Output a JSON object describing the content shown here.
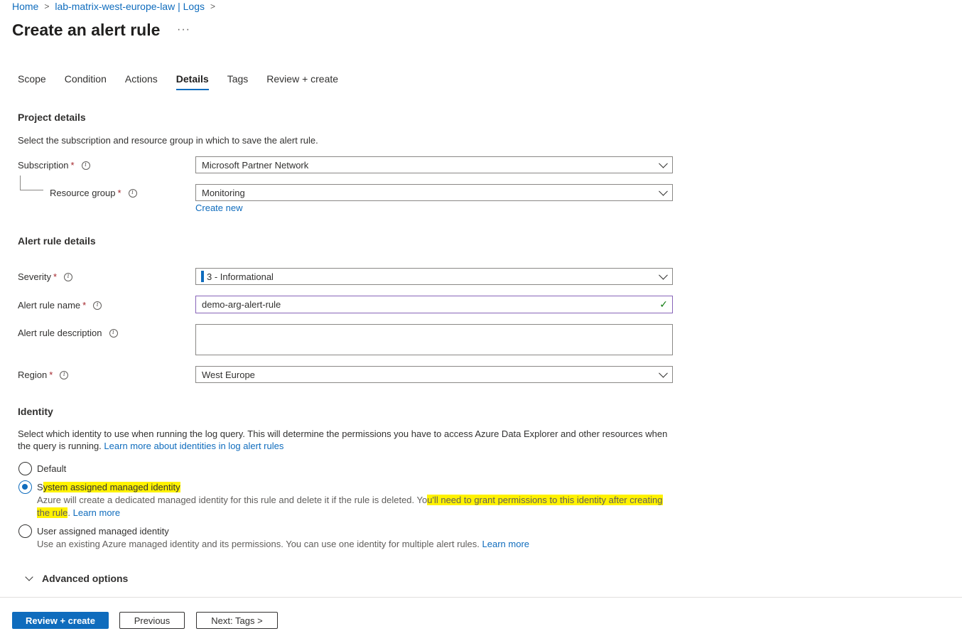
{
  "breadcrumb": {
    "items": [
      "Home",
      "lab-matrix-west-europe-law | Logs"
    ],
    "separator": ">"
  },
  "page": {
    "title": "Create an alert rule",
    "more": "···"
  },
  "tabs": [
    {
      "label": "Scope"
    },
    {
      "label": "Condition"
    },
    {
      "label": "Actions"
    },
    {
      "label": "Details",
      "active": true
    },
    {
      "label": "Tags"
    },
    {
      "label": "Review + create"
    }
  ],
  "project_details": {
    "heading": "Project details",
    "description": "Select the subscription and resource group in which to save the alert rule.",
    "subscription": {
      "label": "Subscription",
      "value": "Microsoft Partner Network"
    },
    "resource_group": {
      "label": "Resource group",
      "value": "Monitoring",
      "create_new": "Create new"
    }
  },
  "alert_rule_details": {
    "heading": "Alert rule details",
    "severity": {
      "label": "Severity",
      "value": "3 - Informational"
    },
    "name": {
      "label": "Alert rule name",
      "value": "demo-arg-alert-rule"
    },
    "description": {
      "label": "Alert rule description",
      "value": ""
    },
    "region": {
      "label": "Region",
      "value": "West Europe"
    }
  },
  "required_mark": "*",
  "info_glyph": "i",
  "identity": {
    "heading": "Identity",
    "description": "Select which identity to use when running the log query. This will determine the permissions you have to access Azure Data Explorer and other resources when",
    "description_line2": "the query is running.",
    "learn_more_identities": "Learn more about identities in log alert rules",
    "options": [
      {
        "label": "Default",
        "checked": false
      },
      {
        "label_pre": "S",
        "label_hl": "ystem assigned managed identity",
        "checked": true,
        "desc_line1_pre": "Azure will create a dedicated managed identity for this rule and delete it if the rule is deleted. Yo",
        "desc_line1_hl": "u'll need to grant permissions to this identity after creating",
        "desc_line2_hl": "the rule",
        "desc_line2_post": ".",
        "learn_more": "Learn more"
      },
      {
        "label": "User assigned managed identity",
        "checked": false,
        "desc": "Use an existing Azure managed identity and its permissions. You can use one identity for multiple alert rules.",
        "learn_more": "Learn more"
      }
    ]
  },
  "advanced": {
    "label": "Advanced options"
  },
  "footer": {
    "review_create": "Review + create",
    "previous": "Previous",
    "next": "Next: Tags >"
  },
  "colors": {
    "accent": "#0f6cbd",
    "highlight": "#fff200",
    "required": "#a4262c",
    "valid": "#107c10"
  }
}
